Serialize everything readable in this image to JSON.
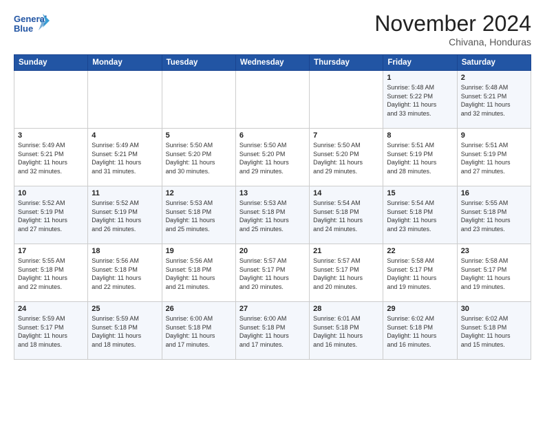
{
  "header": {
    "logo_line1": "General",
    "logo_line2": "Blue",
    "month": "November 2024",
    "location": "Chivana, Honduras"
  },
  "weekdays": [
    "Sunday",
    "Monday",
    "Tuesday",
    "Wednesday",
    "Thursday",
    "Friday",
    "Saturday"
  ],
  "rows": [
    [
      {
        "day": "",
        "info": ""
      },
      {
        "day": "",
        "info": ""
      },
      {
        "day": "",
        "info": ""
      },
      {
        "day": "",
        "info": ""
      },
      {
        "day": "",
        "info": ""
      },
      {
        "day": "1",
        "info": "Sunrise: 5:48 AM\nSunset: 5:22 PM\nDaylight: 11 hours\nand 33 minutes."
      },
      {
        "day": "2",
        "info": "Sunrise: 5:48 AM\nSunset: 5:21 PM\nDaylight: 11 hours\nand 32 minutes."
      }
    ],
    [
      {
        "day": "3",
        "info": "Sunrise: 5:49 AM\nSunset: 5:21 PM\nDaylight: 11 hours\nand 32 minutes."
      },
      {
        "day": "4",
        "info": "Sunrise: 5:49 AM\nSunset: 5:21 PM\nDaylight: 11 hours\nand 31 minutes."
      },
      {
        "day": "5",
        "info": "Sunrise: 5:50 AM\nSunset: 5:20 PM\nDaylight: 11 hours\nand 30 minutes."
      },
      {
        "day": "6",
        "info": "Sunrise: 5:50 AM\nSunset: 5:20 PM\nDaylight: 11 hours\nand 29 minutes."
      },
      {
        "day": "7",
        "info": "Sunrise: 5:50 AM\nSunset: 5:20 PM\nDaylight: 11 hours\nand 29 minutes."
      },
      {
        "day": "8",
        "info": "Sunrise: 5:51 AM\nSunset: 5:19 PM\nDaylight: 11 hours\nand 28 minutes."
      },
      {
        "day": "9",
        "info": "Sunrise: 5:51 AM\nSunset: 5:19 PM\nDaylight: 11 hours\nand 27 minutes."
      }
    ],
    [
      {
        "day": "10",
        "info": "Sunrise: 5:52 AM\nSunset: 5:19 PM\nDaylight: 11 hours\nand 27 minutes."
      },
      {
        "day": "11",
        "info": "Sunrise: 5:52 AM\nSunset: 5:19 PM\nDaylight: 11 hours\nand 26 minutes."
      },
      {
        "day": "12",
        "info": "Sunrise: 5:53 AM\nSunset: 5:18 PM\nDaylight: 11 hours\nand 25 minutes."
      },
      {
        "day": "13",
        "info": "Sunrise: 5:53 AM\nSunset: 5:18 PM\nDaylight: 11 hours\nand 25 minutes."
      },
      {
        "day": "14",
        "info": "Sunrise: 5:54 AM\nSunset: 5:18 PM\nDaylight: 11 hours\nand 24 minutes."
      },
      {
        "day": "15",
        "info": "Sunrise: 5:54 AM\nSunset: 5:18 PM\nDaylight: 11 hours\nand 23 minutes."
      },
      {
        "day": "16",
        "info": "Sunrise: 5:55 AM\nSunset: 5:18 PM\nDaylight: 11 hours\nand 23 minutes."
      }
    ],
    [
      {
        "day": "17",
        "info": "Sunrise: 5:55 AM\nSunset: 5:18 PM\nDaylight: 11 hours\nand 22 minutes."
      },
      {
        "day": "18",
        "info": "Sunrise: 5:56 AM\nSunset: 5:18 PM\nDaylight: 11 hours\nand 22 minutes."
      },
      {
        "day": "19",
        "info": "Sunrise: 5:56 AM\nSunset: 5:18 PM\nDaylight: 11 hours\nand 21 minutes."
      },
      {
        "day": "20",
        "info": "Sunrise: 5:57 AM\nSunset: 5:17 PM\nDaylight: 11 hours\nand 20 minutes."
      },
      {
        "day": "21",
        "info": "Sunrise: 5:57 AM\nSunset: 5:17 PM\nDaylight: 11 hours\nand 20 minutes."
      },
      {
        "day": "22",
        "info": "Sunrise: 5:58 AM\nSunset: 5:17 PM\nDaylight: 11 hours\nand 19 minutes."
      },
      {
        "day": "23",
        "info": "Sunrise: 5:58 AM\nSunset: 5:17 PM\nDaylight: 11 hours\nand 19 minutes."
      }
    ],
    [
      {
        "day": "24",
        "info": "Sunrise: 5:59 AM\nSunset: 5:17 PM\nDaylight: 11 hours\nand 18 minutes."
      },
      {
        "day": "25",
        "info": "Sunrise: 5:59 AM\nSunset: 5:18 PM\nDaylight: 11 hours\nand 18 minutes."
      },
      {
        "day": "26",
        "info": "Sunrise: 6:00 AM\nSunset: 5:18 PM\nDaylight: 11 hours\nand 17 minutes."
      },
      {
        "day": "27",
        "info": "Sunrise: 6:00 AM\nSunset: 5:18 PM\nDaylight: 11 hours\nand 17 minutes."
      },
      {
        "day": "28",
        "info": "Sunrise: 6:01 AM\nSunset: 5:18 PM\nDaylight: 11 hours\nand 16 minutes."
      },
      {
        "day": "29",
        "info": "Sunrise: 6:02 AM\nSunset: 5:18 PM\nDaylight: 11 hours\nand 16 minutes."
      },
      {
        "day": "30",
        "info": "Sunrise: 6:02 AM\nSunset: 5:18 PM\nDaylight: 11 hours\nand 15 minutes."
      }
    ]
  ]
}
